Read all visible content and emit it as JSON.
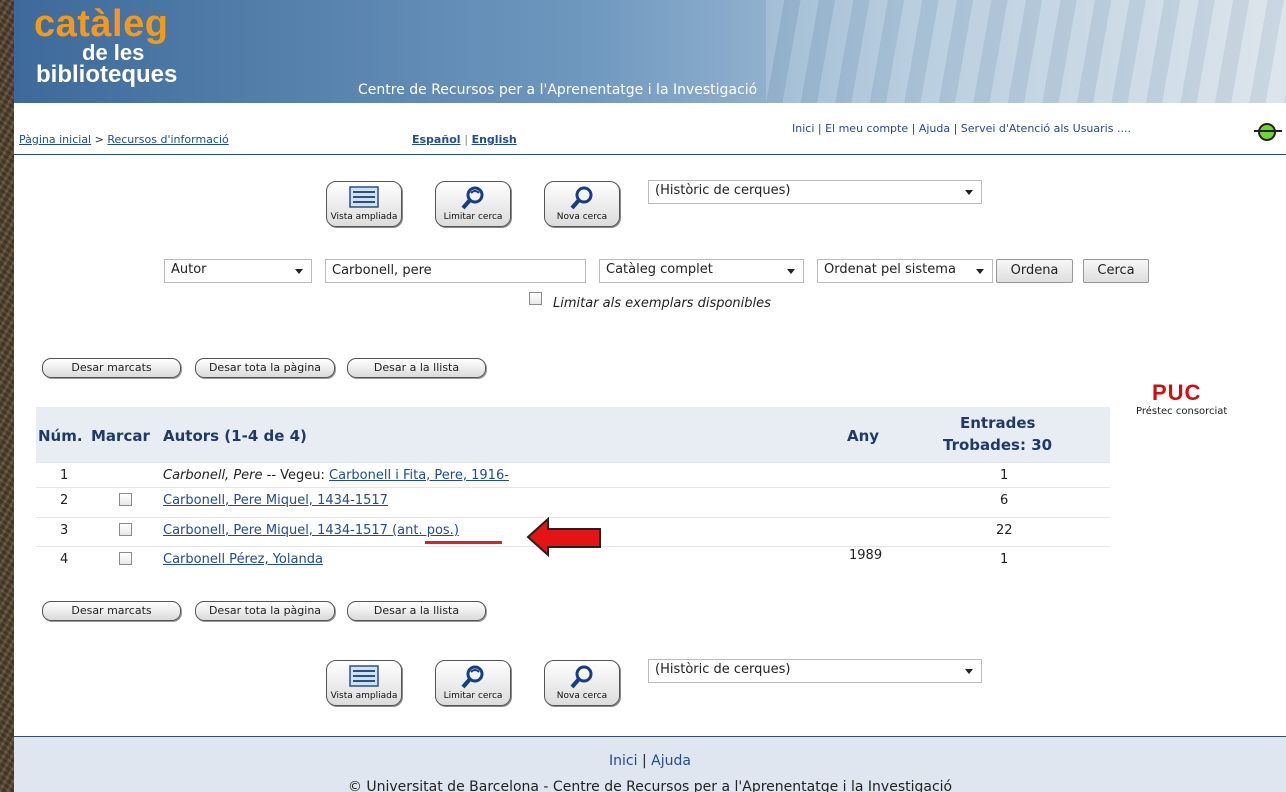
{
  "header": {
    "logo_line1": "catàleg",
    "logo_line2": "de les",
    "logo_line3": "biblioteques",
    "center_title": "Centre de Recursos per a l'Aprenentatge i la Investigació"
  },
  "nav": {
    "breadcrumb_home": "Pàgina inicial",
    "breadcrumb_sep": ">",
    "breadcrumb_current": "Recursos d'informació",
    "lang_es": "Español",
    "lang_sep": "|",
    "lang_en": "English",
    "top_links": [
      "Inici",
      "El meu compte",
      "Ajuda",
      "Servei d'Atenció als Usuaris"
    ],
    "top_sep": "|",
    "help_suffix": "...."
  },
  "toolbar": {
    "expanded_view": "Vista ampliada",
    "limit_search": "Limitar cerca",
    "new_search": "Nova cerca",
    "history_select": "(Històric de cerques)"
  },
  "search": {
    "field_type": "Autor",
    "query": "Carbonell, pere",
    "scope": "Catàleg complet",
    "sort": "Ordenat pel sistema",
    "sort_button": "Ordena",
    "search_button": "Cerca",
    "limit_available": "Limitar als exemplars disponibles"
  },
  "actions": {
    "save_marked": "Desar marcats",
    "save_page": "Desar tota la pàgina",
    "save_to_list": "Desar a la llista"
  },
  "puc": {
    "logo": "PUC",
    "subtitle": "Préstec consorciat"
  },
  "results": {
    "headers": {
      "num": "Núm.",
      "mark": "Marcar",
      "authors": "Autors (1-4 de 4)",
      "year": "Any",
      "entries_line1": "Entrades",
      "entries_line2": "Trobades: 30"
    },
    "rows": [
      {
        "num": "1",
        "italic": "Carbonell, Pere",
        "see": " -- Vegeu: ",
        "link": "Carbonell i Fita, Pere, 1916-",
        "year": "",
        "entries": "1"
      },
      {
        "num": "2",
        "link": "Carbonell, Pere Miquel, 1434-1517",
        "year": "",
        "entries": "6"
      },
      {
        "num": "3",
        "link": "Carbonell, Pere Miquel, 1434-1517 (ant. pos.)",
        "year": "",
        "entries": "22"
      },
      {
        "num": "4",
        "link": "Carbonell Pérez, Yolanda",
        "year": "1989",
        "entries": "1"
      }
    ]
  },
  "footer": {
    "link_home": "Inici",
    "sep": "|",
    "link_help": "Ajuda",
    "copyright": "© Universitat de Barcelona - Centre de Recursos per a l'Aprenentatge i la Investigació"
  }
}
